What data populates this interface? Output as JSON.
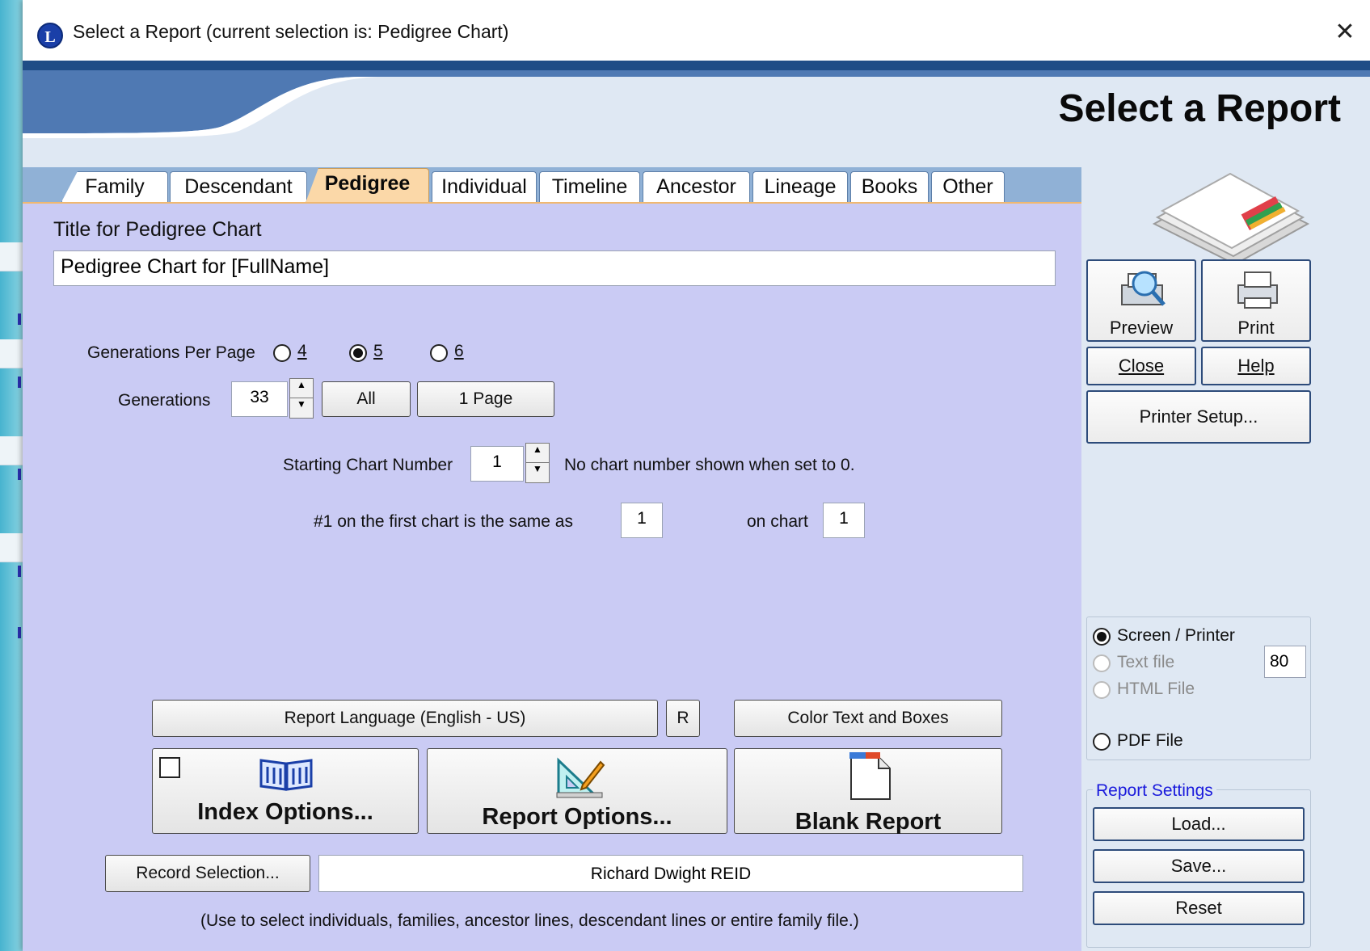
{
  "window": {
    "title": "Select a Report  (current selection is: Pedigree Chart)",
    "close_glyph": "✕",
    "app_icon_letter": "L"
  },
  "header": {
    "title": "Select a Report"
  },
  "tabs": [
    {
      "label": "Family",
      "active": false
    },
    {
      "label": "Descendant",
      "active": false
    },
    {
      "label": "Pedigree",
      "active": true
    },
    {
      "label": "Individual",
      "active": false
    },
    {
      "label": "Timeline",
      "active": false
    },
    {
      "label": "Ancestor",
      "active": false
    },
    {
      "label": "Lineage",
      "active": false
    },
    {
      "label": "Books",
      "active": false
    },
    {
      "label": "Other",
      "active": false
    }
  ],
  "form": {
    "title_label": "Title for Pedigree Chart",
    "title_value": "Pedigree Chart for [FullName]",
    "gen_per_page_label": "Generations Per Page",
    "gen_options": [
      "4",
      "5",
      "6"
    ],
    "gen_selected": "5",
    "generations_label": "Generations",
    "generations_value": "33",
    "all_button": "All",
    "one_page_button": "1 Page",
    "starting_label": "Starting Chart Number",
    "starting_value": "1",
    "starting_note": "No chart number shown when set to 0.",
    "first_chart_label": "#1 on the first chart is the same as",
    "first_chart_value": "1",
    "on_chart_label": "on chart",
    "on_chart_value": "1"
  },
  "bottom": {
    "report_language": "Report Language (English - US)",
    "r_button": "R",
    "color_button": "Color Text and Boxes",
    "index_options": "Index Options...",
    "report_options": "Report Options...",
    "blank_report": "Blank Report",
    "record_selection": "Record Selection...",
    "selected_person": "Richard Dwight REID",
    "hint": "(Use to select individuals, families, ancestor lines, descendant lines or entire family file.)"
  },
  "side": {
    "preview": "Preview",
    "print": "Print",
    "close": "Close",
    "help": "Help",
    "printer_setup": "Printer Setup...",
    "output": {
      "screen_printer": "Screen / Printer",
      "text_file": "Text file",
      "html_file": "HTML File",
      "pdf_file": "PDF File",
      "width_value": "80",
      "selected": "Screen / Printer"
    },
    "settings": {
      "group_label": "Report Settings",
      "load": "Load...",
      "save": "Save...",
      "reset": "Reset"
    }
  },
  "colors": {
    "main_panel": "#cacbf4",
    "active_tab": "#fbd8a8",
    "side_panel": "#dfe8f3",
    "link_blue": "#1a1adc"
  }
}
